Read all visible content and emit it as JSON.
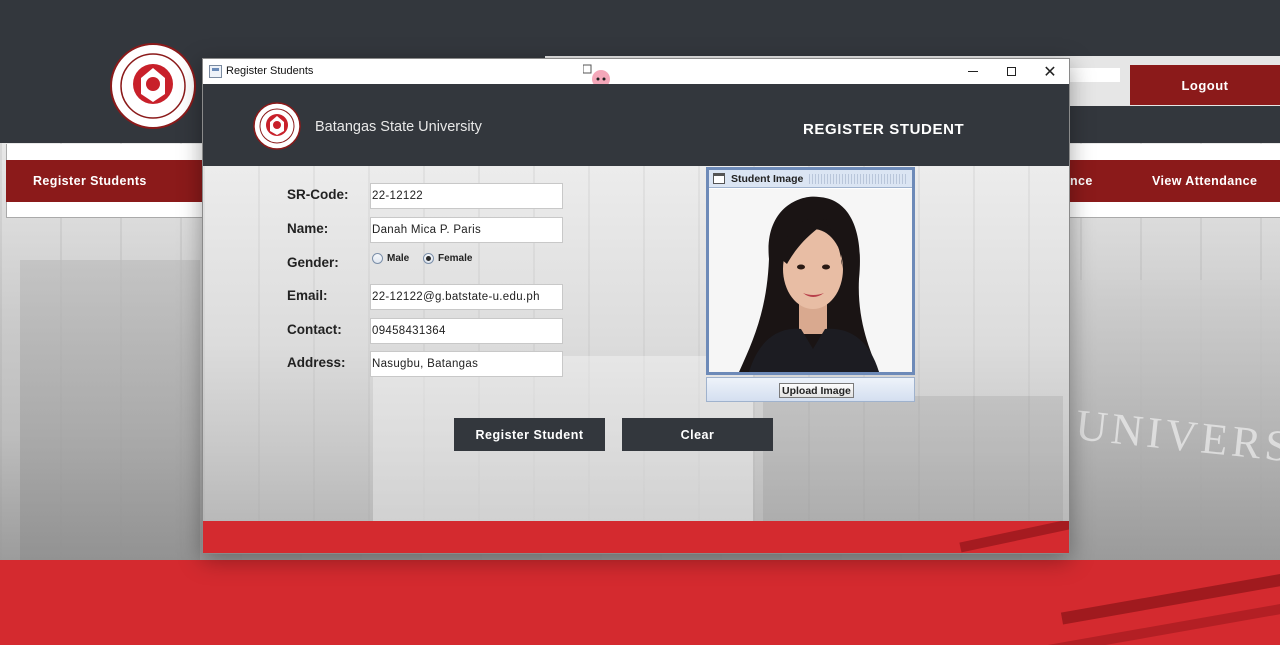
{
  "app": {
    "logout_label": "Logout",
    "nav": {
      "register_students": "Register Students",
      "attendance_partial": "nce",
      "view_attendance": "View Attendance"
    }
  },
  "dialog": {
    "window_title": "Register Students",
    "header": {
      "university_name": "Batangas State University",
      "page_title": "REGISTER STUDENT"
    },
    "form": {
      "sr_code": {
        "label": "SR-Code:",
        "value": "22-12122"
      },
      "name": {
        "label": "Name:",
        "value": "Danah Mica P. Paris"
      },
      "gender": {
        "label": "Gender:",
        "options": [
          "Male",
          "Female"
        ],
        "selected": "Female"
      },
      "email": {
        "label": "Email:",
        "value": "22-12122@g.batstate-u.edu.ph"
      },
      "contact": {
        "label": "Contact:",
        "value": "09458431364"
      },
      "address": {
        "label": "Address:",
        "value": "Nasugbu, Batangas"
      }
    },
    "buttons": {
      "register": "Register Student",
      "clear": "Clear"
    },
    "image_panel": {
      "title": "Student Image",
      "upload_label": "Upload Image"
    }
  },
  "colors": {
    "dark_header": "#33373d",
    "maroon": "#8b1a1a",
    "red_footer": "#d42a2f",
    "frame_blue": "#6d8ab8"
  },
  "icons": [
    "java-app-icon",
    "minimize-icon",
    "maximize-icon",
    "close-icon",
    "mascot-icon",
    "university-seal-icon",
    "internal-frame-icon"
  ]
}
